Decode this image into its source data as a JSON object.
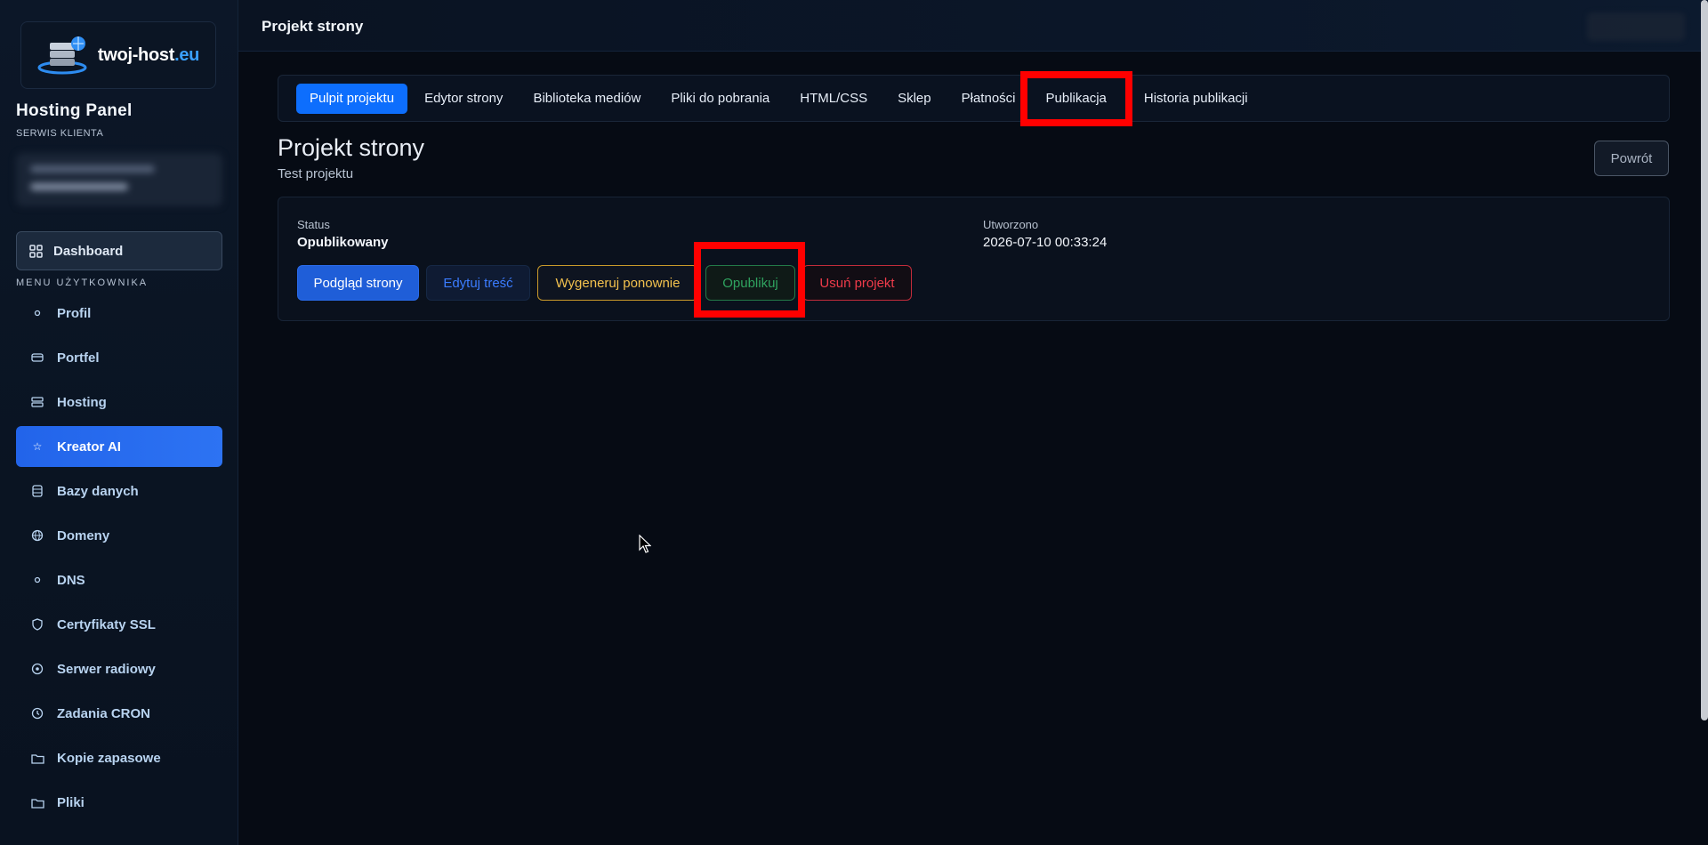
{
  "brand": {
    "name": "twoj-host",
    "tld": ".eu"
  },
  "panel": {
    "title": "Hosting Panel",
    "subtitle": "SERWIS KLIENTA"
  },
  "sidebar": {
    "dashboard_label": "Dashboard",
    "menu_label": "MENU UŻYTKOWNIKA",
    "items": [
      {
        "label": "Profil",
        "icon": "dot-icon"
      },
      {
        "label": "Portfel",
        "icon": "wallet-icon"
      },
      {
        "label": "Hosting",
        "icon": "server-icon"
      },
      {
        "label": "Kreator AI",
        "icon": "star-icon",
        "active": true
      },
      {
        "label": "Bazy danych",
        "icon": "database-icon"
      },
      {
        "label": "Domeny",
        "icon": "globe-icon"
      },
      {
        "label": "DNS",
        "icon": "dot-icon"
      },
      {
        "label": "Certyfikaty SSL",
        "icon": "shield-icon"
      },
      {
        "label": "Serwer radiowy",
        "icon": "radio-icon"
      },
      {
        "label": "Zadania CRON",
        "icon": "clock-icon"
      },
      {
        "label": "Kopie zapasowe",
        "icon": "folder-icon"
      },
      {
        "label": "Pliki",
        "icon": "folder-icon"
      }
    ]
  },
  "topbar": {
    "title": "Projekt strony"
  },
  "tabs": [
    {
      "label": "Pulpit projektu",
      "active": true
    },
    {
      "label": "Edytor strony"
    },
    {
      "label": "Biblioteka mediów"
    },
    {
      "label": "Pliki do pobrania"
    },
    {
      "label": "HTML/CSS"
    },
    {
      "label": "Sklep"
    },
    {
      "label": "Płatności"
    },
    {
      "label": "Publikacja",
      "highlighted": true
    },
    {
      "label": "Historia publikacji"
    }
  ],
  "page": {
    "title": "Projekt strony",
    "subtitle": "Test projektu",
    "back_label": "Powrót"
  },
  "project": {
    "status_label": "Status",
    "status_value": "Opublikowany",
    "created_label": "Utworzono",
    "created_value": "2026-07-10 00:33:24"
  },
  "actions": {
    "preview": "Podgląd strony",
    "edit": "Edytuj treść",
    "regenerate": "Wygeneruj ponownie",
    "publish": "Opublikuj",
    "delete": "Usuń projekt"
  },
  "colors": {
    "accent": "#0d6efd",
    "highlight": "#ff0000",
    "success": "#2fa35f",
    "warning": "#f2c14e",
    "danger": "#ef3b4a"
  }
}
